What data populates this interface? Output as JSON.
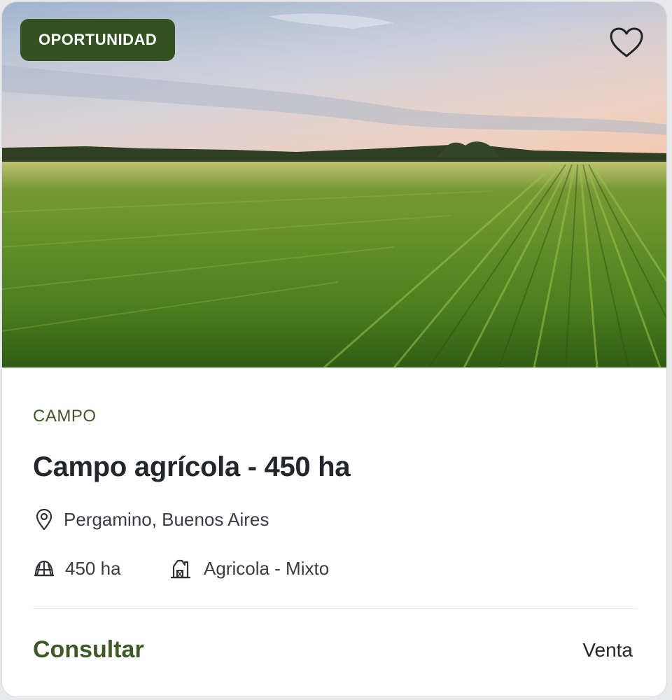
{
  "listing": {
    "badge": "OPORTUNIDAD",
    "category": "CAMPO",
    "title": "Campo agrícola - 450 ha",
    "location": "Pergamino, Buenos Aires",
    "area": "450 ha",
    "type": "Agricola - Mixto",
    "price_action": "Consultar",
    "operation": "Venta"
  },
  "icons": {
    "favorite": "heart-icon",
    "location": "map-pin-icon",
    "area": "field-icon",
    "type": "barn-icon"
  },
  "colors": {
    "accent": "#33521f",
    "accent_text": "#3e5a26",
    "title": "#23262b",
    "body_text": "#3a3d42"
  }
}
